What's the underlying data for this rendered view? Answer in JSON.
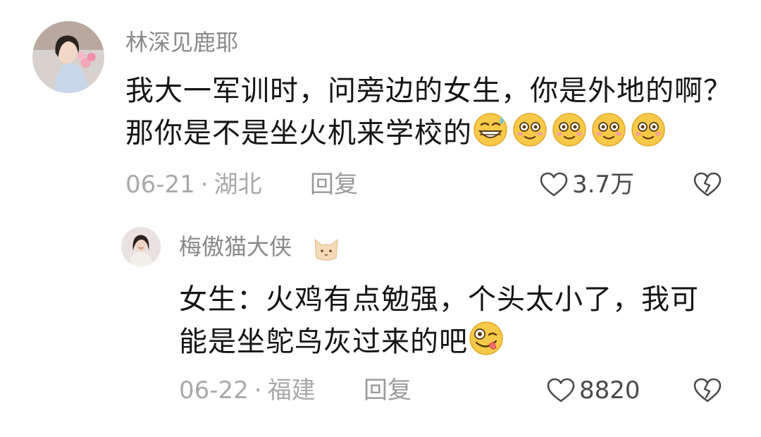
{
  "comment": {
    "username": "林深见鹿耶",
    "text_lines": [
      "我大一军训时，问旁边的女生，你是外地的啊？",
      "那你是不是坐火机来学校的"
    ],
    "emojis": [
      "grin-sweat-emoji",
      "flushed-emoji",
      "flushed-emoji",
      "flushed-emoji",
      "flushed-emoji"
    ],
    "date": "06-21",
    "separator": "·",
    "location": "湖北",
    "reply_label": "回复",
    "like_count": "3.7万"
  },
  "reply": {
    "username": "梅傲猫大侠",
    "username_badge": "cat-face-icon",
    "text_lines": [
      "女生：火鸡有点勉强，个头太小了，我可",
      "能是坐鸵鸟灰过来的吧"
    ],
    "emojis": [
      "zany-face-emoji"
    ],
    "date": "06-22",
    "separator": "·",
    "location": "福建",
    "reply_label": "回复",
    "like_count": "8820"
  },
  "colors": {
    "text_primary": "#151515",
    "text_secondary": "#8a8a8a",
    "emoji_yellow": "#f7c948"
  }
}
